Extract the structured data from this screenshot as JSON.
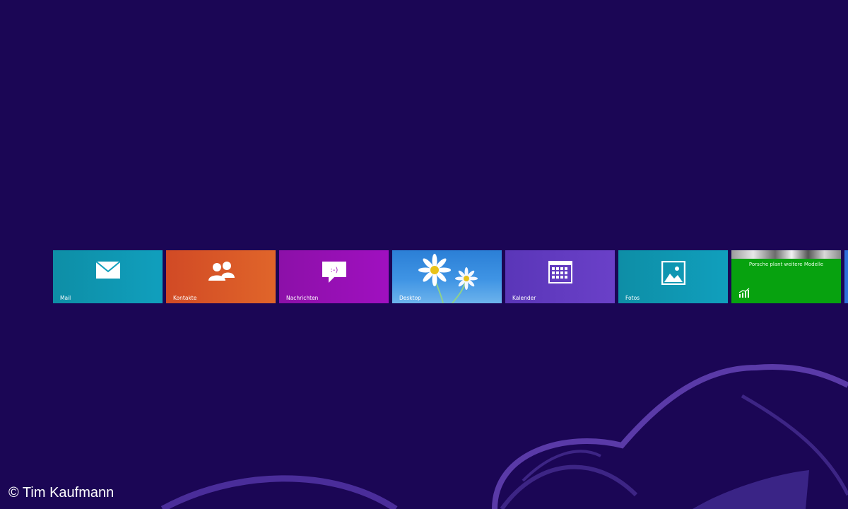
{
  "colors": {
    "background": "#1b0655",
    "swirl": "#5a3aa8"
  },
  "tiles": [
    {
      "label": "Mail",
      "icon": "mail-icon",
      "color": "#109fbd"
    },
    {
      "label": "Kontakte",
      "icon": "people-icon",
      "color": "#e0652a"
    },
    {
      "label": "Nachrichten",
      "icon": "message-icon",
      "color": "#a010c0",
      "icon_text": ":-)"
    },
    {
      "label": "Desktop",
      "icon": "daisy-wallpaper",
      "color": "#3f94e4"
    },
    {
      "label": "Kalender",
      "icon": "calendar-icon",
      "color": "#6a40c8"
    },
    {
      "label": "Fotos",
      "icon": "photo-icon",
      "color": "#109fbd"
    },
    {
      "label": "",
      "icon": "chart-icon",
      "color": "#07a20f",
      "headline": "Porsche plant weitere Modelle"
    }
  ],
  "watermark": "© Tim Kaufmann"
}
